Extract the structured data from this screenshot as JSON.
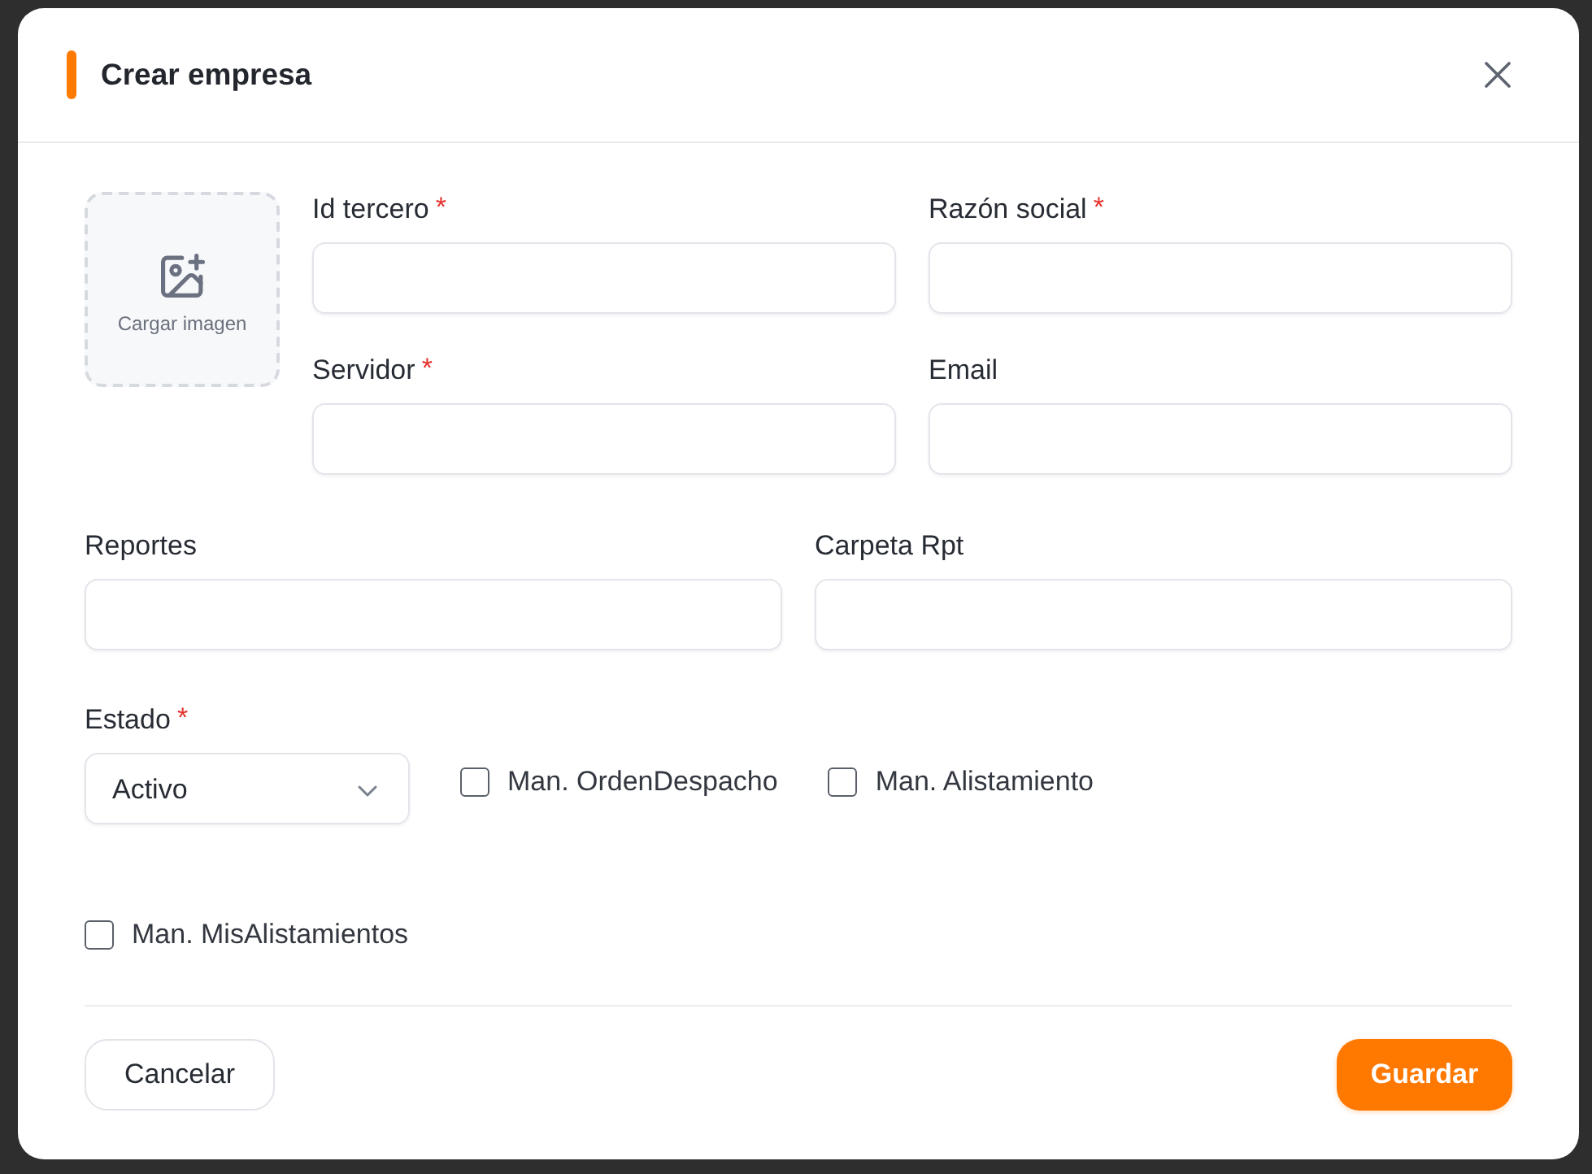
{
  "dialog": {
    "title": "Crear empresa"
  },
  "image_upload": {
    "label": "Cargar imagen"
  },
  "main_fields": [
    {
      "label": "Id tercero",
      "required_mark": "*"
    },
    {
      "label": "Razón social",
      "required_mark": "*"
    },
    {
      "label": "Servidor",
      "required_mark": "*"
    },
    {
      "label": "Email"
    }
  ],
  "report_fields": [
    {
      "label": "Reportes"
    },
    {
      "label": "Carpeta Rpt"
    }
  ],
  "status": {
    "label": "Estado",
    "required_mark": "*",
    "value": "Activo"
  },
  "checkboxes": [
    {
      "label": "Man. OrdenDespacho",
      "checked": false
    },
    {
      "label": "Man. Alistamiento",
      "checked": false
    },
    {
      "label": "Man. MisAlistamientos",
      "checked": false
    }
  ],
  "buttons": [
    {
      "label": "Cancelar",
      "kind": "secondary"
    },
    {
      "label": "Guardar",
      "kind": "primary"
    }
  ]
}
